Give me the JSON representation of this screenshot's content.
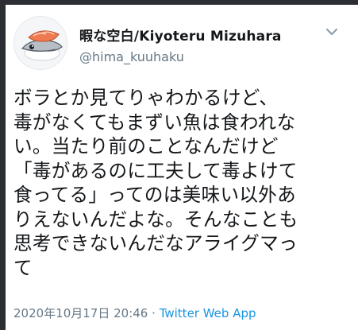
{
  "tweet": {
    "display_name": "暇な空白/Kiyoteru Mizuhara",
    "handle": "@hima_kuuhaku",
    "text": "ボラとか見てりゃわかるけど、\n毒がなくてもまずい魚は食われな\nい。当たり前のことなんだけど\n「毒があるのに工夫して毒よけて\n食ってる」ってのは美味い以外あ\nりえないんだよな。そんなことも\n思考できないんだなアライグマっ\nて",
    "timestamp": "2020年10月17日 20:46",
    "separator": "·",
    "source": "Twitter Web App"
  },
  "icons": {
    "avatar": "sushi-fish-avatar-icon",
    "menu": "chevron-down-icon"
  },
  "colors": {
    "text": "#14171a",
    "secondary": "#657786",
    "link": "#1b95e0",
    "avatar_salmon": "#f07a4f"
  }
}
